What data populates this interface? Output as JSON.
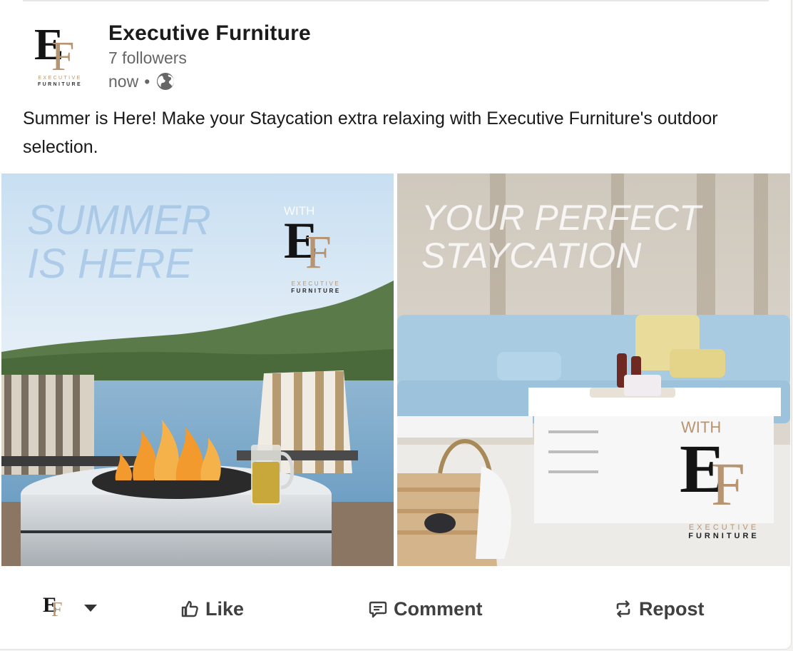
{
  "post": {
    "company_name": "Executive Furniture",
    "followers": "7 followers",
    "time": "now",
    "time_separator": "•",
    "text": "Summer is Here! Make your Staycation extra relaxing with Executive Furniture's outdoor selection."
  },
  "logo": {
    "letter_e": "E",
    "letter_f": "F",
    "word_top": "EXECUTIVE",
    "word_bottom": "FURNITURE"
  },
  "images": {
    "left": {
      "headline": "SUMMER\nIS HERE",
      "with": "WITH",
      "icons": [
        "fire-pit",
        "adirondack-chair",
        "tea-glass"
      ]
    },
    "right": {
      "headline": "YOUR PERFECT\nSTAYCATION",
      "with": "WITH",
      "icons": [
        "outdoor-sofa",
        "coffee-table",
        "straw-bag"
      ]
    }
  },
  "actions": {
    "like": "Like",
    "comment": "Comment",
    "repost": "Repost"
  },
  "colors": {
    "brand_gold": "#b79472",
    "text_dark": "#191919",
    "text_muted": "#666666",
    "action_text": "#404040"
  }
}
